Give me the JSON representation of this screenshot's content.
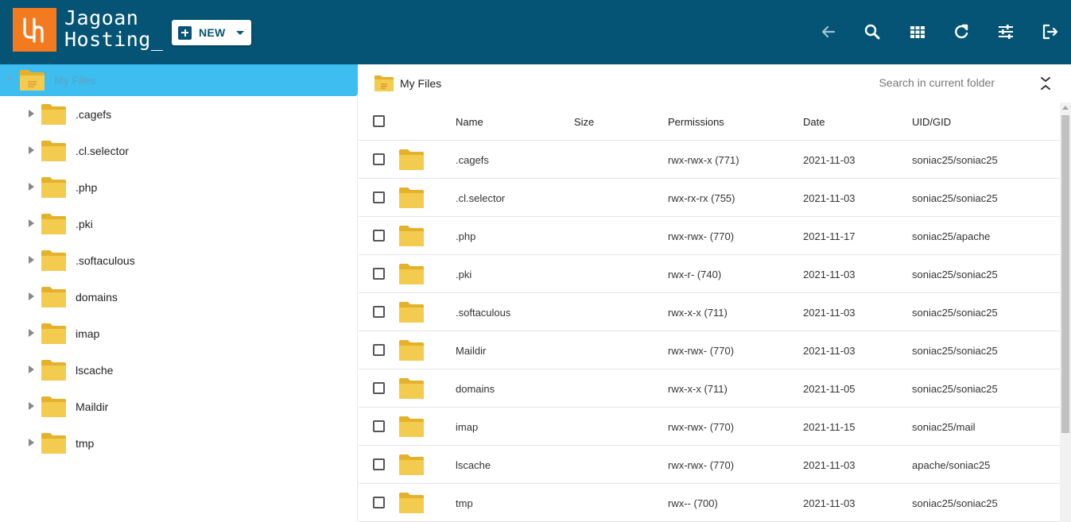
{
  "brand": {
    "line1": "Jagoan",
    "line2": "Hosting_",
    "mark_text": "JH",
    "accent_color": "#f47a20",
    "header_color": "#055475"
  },
  "toolbar": {
    "new_label": "NEW",
    "icons": [
      "back-arrow-icon",
      "search-icon",
      "grid-view-icon",
      "refresh-icon",
      "settings-sliders-icon",
      "logout-icon"
    ]
  },
  "sidebar": {
    "root_label": "My Files",
    "items": [
      {
        "label": ".cagefs"
      },
      {
        "label": ".cl.selector"
      },
      {
        "label": ".php"
      },
      {
        "label": ".pki"
      },
      {
        "label": ".softaculous"
      },
      {
        "label": "domains"
      },
      {
        "label": "imap"
      },
      {
        "label": "lscache"
      },
      {
        "label": "Maildir"
      },
      {
        "label": "tmp"
      }
    ]
  },
  "main": {
    "breadcrumb": "My Files",
    "search_placeholder": "Search in current folder",
    "columns": {
      "name": "Name",
      "size": "Size",
      "permissions": "Permissions",
      "date": "Date",
      "uid": "UID/GID"
    },
    "rows": [
      {
        "name": ".cagefs",
        "size": "",
        "perm": "rwx-rwx-x (771)",
        "date": "2021-11-03",
        "uid": "soniac25/soniac25"
      },
      {
        "name": ".cl.selector",
        "size": "",
        "perm": "rwx-rx-rx (755)",
        "date": "2021-11-03",
        "uid": "soniac25/soniac25"
      },
      {
        "name": ".php",
        "size": "",
        "perm": "rwx-rwx- (770)",
        "date": "2021-11-17",
        "uid": "soniac25/apache"
      },
      {
        "name": ".pki",
        "size": "",
        "perm": "rwx-r- (740)",
        "date": "2021-11-03",
        "uid": "soniac25/soniac25"
      },
      {
        "name": ".softaculous",
        "size": "",
        "perm": "rwx-x-x (711)",
        "date": "2021-11-03",
        "uid": "soniac25/soniac25"
      },
      {
        "name": "Maildir",
        "size": "",
        "perm": "rwx-rwx- (770)",
        "date": "2021-11-03",
        "uid": "soniac25/soniac25"
      },
      {
        "name": "domains",
        "size": "",
        "perm": "rwx-x-x (711)",
        "date": "2021-11-05",
        "uid": "soniac25/soniac25"
      },
      {
        "name": "imap",
        "size": "",
        "perm": "rwx-rwx- (770)",
        "date": "2021-11-15",
        "uid": "soniac25/mail"
      },
      {
        "name": "lscache",
        "size": "",
        "perm": "rwx-rwx- (770)",
        "date": "2021-11-03",
        "uid": "apache/soniac25"
      },
      {
        "name": "tmp",
        "size": "",
        "perm": "rwx-- (700)",
        "date": "2021-11-03",
        "uid": "soniac25/soniac25"
      }
    ]
  }
}
